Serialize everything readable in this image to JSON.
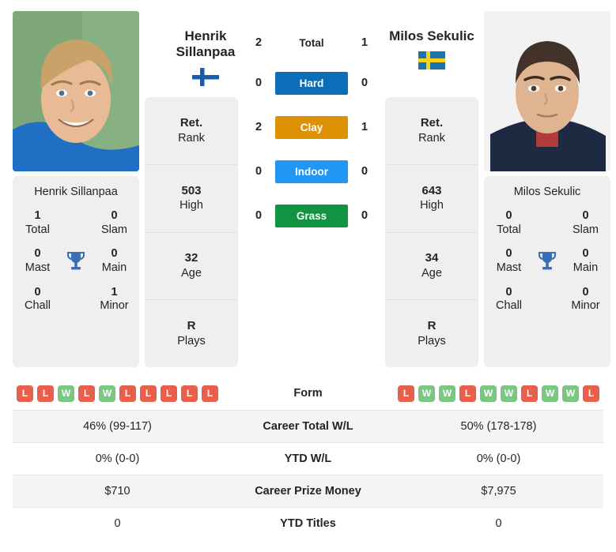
{
  "players": {
    "left": {
      "name": "Henrik Sillanpaa",
      "display_name_line1": "Henrik",
      "display_name_line2": "Sillanpaa",
      "country": "Finland",
      "flag": "flag-finland",
      "photo_alt": "henrik-sillanpaa-photo",
      "titles": {
        "total": "1",
        "total_label": "Total",
        "slam": "0",
        "slam_label": "Slam",
        "mast": "0",
        "mast_label": "Mast",
        "main": "0",
        "main_label": "Main",
        "chall": "0",
        "chall_label": "Chall",
        "minor": "1",
        "minor_label": "Minor"
      },
      "stats": [
        {
          "value": "Ret.",
          "label": "Rank"
        },
        {
          "value": "503",
          "label": "High"
        },
        {
          "value": "32",
          "label": "Age"
        },
        {
          "value": "R",
          "label": "Plays"
        }
      ],
      "form": [
        "L",
        "L",
        "W",
        "L",
        "W",
        "L",
        "L",
        "L",
        "L",
        "L"
      ],
      "career_total_wl": "46% (99-117)",
      "ytd_wl": "0% (0-0)",
      "career_prize_money": "$710",
      "ytd_titles": "0"
    },
    "right": {
      "name": "Milos Sekulic",
      "display_name_line1": "Milos Sekulic",
      "display_name_line2": "",
      "country": "Sweden",
      "flag": "flag-sweden",
      "photo_alt": "milos-sekulic-photo",
      "titles": {
        "total": "0",
        "total_label": "Total",
        "slam": "0",
        "slam_label": "Slam",
        "mast": "0",
        "mast_label": "Mast",
        "main": "0",
        "main_label": "Main",
        "chall": "0",
        "chall_label": "Chall",
        "minor": "0",
        "minor_label": "Minor"
      },
      "stats": [
        {
          "value": "Ret.",
          "label": "Rank"
        },
        {
          "value": "643",
          "label": "High"
        },
        {
          "value": "34",
          "label": "Age"
        },
        {
          "value": "R",
          "label": "Plays"
        }
      ],
      "form": [
        "L",
        "W",
        "W",
        "L",
        "W",
        "W",
        "L",
        "W",
        "W",
        "L"
      ],
      "career_total_wl": "50% (178-178)",
      "ytd_wl": "0% (0-0)",
      "career_prize_money": "$7,975",
      "ytd_titles": "0"
    }
  },
  "head_to_head": {
    "total": {
      "label": "Total",
      "left": "2",
      "right": "1"
    },
    "surfaces": [
      {
        "label": "Hard",
        "left": "0",
        "right": "0",
        "color": "#0c6eb8"
      },
      {
        "label": "Clay",
        "left": "2",
        "right": "1",
        "color": "#dd9206"
      },
      {
        "label": "Indoor",
        "left": "0",
        "right": "0",
        "color": "#2196f3"
      },
      {
        "label": "Grass",
        "left": "0",
        "right": "0",
        "color": "#109441"
      }
    ]
  },
  "comparison_rows": [
    {
      "label": "Form",
      "key": "form",
      "type": "form"
    },
    {
      "label": "Career Total W/L",
      "key": "career_total_wl",
      "type": "text"
    },
    {
      "label": "YTD W/L",
      "key": "ytd_wl",
      "type": "text"
    },
    {
      "label": "Career Prize Money",
      "key": "career_prize_money",
      "type": "text"
    },
    {
      "label": "YTD Titles",
      "key": "ytd_titles",
      "type": "text"
    }
  ],
  "icons": {
    "trophy": "trophy-icon"
  },
  "colors": {
    "win": "#7ac77f",
    "loss": "#e8604c",
    "trophy": "#3a6fb5",
    "panel": "#efefef",
    "row_alt": "#f4f4f4"
  }
}
